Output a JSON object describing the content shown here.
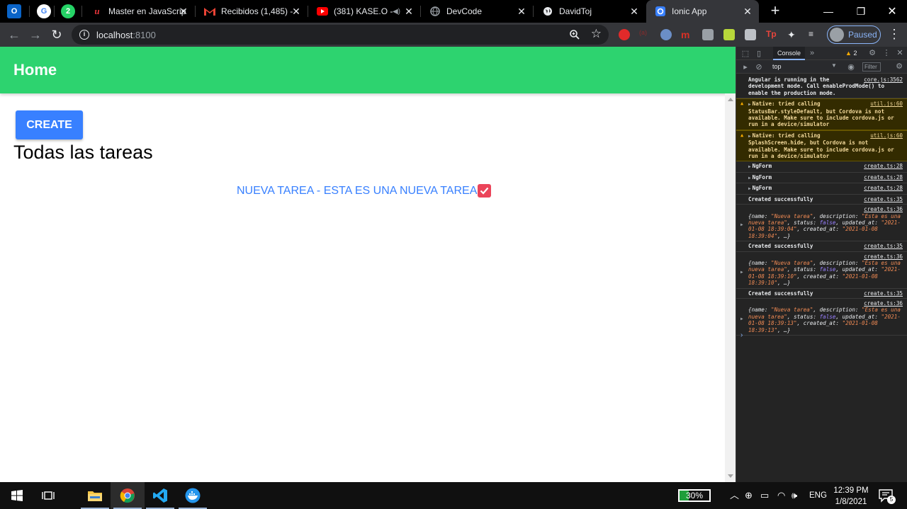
{
  "browser": {
    "tabs": [
      {
        "title": "Master en JavaScrip",
        "icon": "udemy-icon",
        "active": false
      },
      {
        "title": "Recibidos (1,485) -",
        "icon": "gmail-icon",
        "active": false
      },
      {
        "title": "(381) KASE.O -",
        "icon": "youtube-icon",
        "active": false
      },
      {
        "title": "DevCode",
        "icon": "globe-icon",
        "active": false
      },
      {
        "title": "DavidToj",
        "icon": "globe-icon",
        "active": false
      },
      {
        "title": "Ionic App",
        "icon": "ionic-icon",
        "active": true
      }
    ],
    "pinned_badge": "2",
    "address": {
      "host": "localhost",
      "port": ":8100"
    },
    "profile_status": "Paused"
  },
  "app": {
    "header_title": "Home",
    "create_label": "CREATE",
    "heading": "Todas las tareas",
    "tasks": [
      {
        "text": "NUEVA TAREA - ESTA ES UNA NUEVA TAREA",
        "checked": true
      }
    ],
    "colors": {
      "header": "#2dd36f",
      "primary": "#3880ff",
      "danger": "#eb445a"
    }
  },
  "devtools": {
    "active_tab": "Console",
    "warning_count": "2",
    "context": "top",
    "filter_label": "Filter",
    "messages": [
      {
        "type": "info",
        "text": "Angular is running in the development mode. Call enableProdMode() to enable the production mode.",
        "source": "core.js:3562"
      },
      {
        "type": "warn",
        "text": "Native: tried calling StatusBar.styleDefault, but Cordova is not available. Make sure to include cordova.js or run in a device/simulator",
        "source": "util.js:60"
      },
      {
        "type": "warn",
        "text": "Native: tried calling SplashScreen.hide, but Cordova is not available. Make sure to include cordova.js or run in a device/simulator",
        "source": "util.js:60"
      },
      {
        "type": "log",
        "text": "NgForm",
        "source": "create.ts:28"
      },
      {
        "type": "log",
        "text": "NgForm",
        "source": "create.ts:28"
      },
      {
        "type": "log",
        "text": "NgForm",
        "source": "create.ts:28"
      },
      {
        "type": "log",
        "text": "Created successfully",
        "source": "create.ts:35"
      },
      {
        "type": "obj",
        "source": "create.ts:36",
        "name": "\"Nueva tarea\"",
        "description": "\"Esta es una nueva tarea\"",
        "status": "false",
        "updated_at": "\"2021-01-08 18:39:04\"",
        "created_at": "\"2021-01-08 18:39:04\""
      },
      {
        "type": "log",
        "text": "Created successfully",
        "source": "create.ts:35"
      },
      {
        "type": "obj",
        "source": "create.ts:36",
        "name": "\"Nueva tarea\"",
        "description": "\"Esta es una nueva tarea\"",
        "status": "false",
        "updated_at": "\"2021-01-08 18:39:10\"",
        "created_at": "\"2021-01-08 18:39:10\""
      },
      {
        "type": "log",
        "text": "Created successfully",
        "source": "create.ts:35"
      },
      {
        "type": "obj",
        "source": "create.ts:36",
        "name": "\"Nueva tarea\"",
        "description": "\"Esta es una nueva tarea\"",
        "status": "false",
        "updated_at": "\"2021-01-08 18:39:13\"",
        "created_at": "\"2021-01-08 18:39:13\""
      }
    ]
  },
  "taskbar": {
    "battery": "30%",
    "language": "ENG",
    "time": "12:39 PM",
    "date": "1/8/2021",
    "notifications": "5"
  }
}
